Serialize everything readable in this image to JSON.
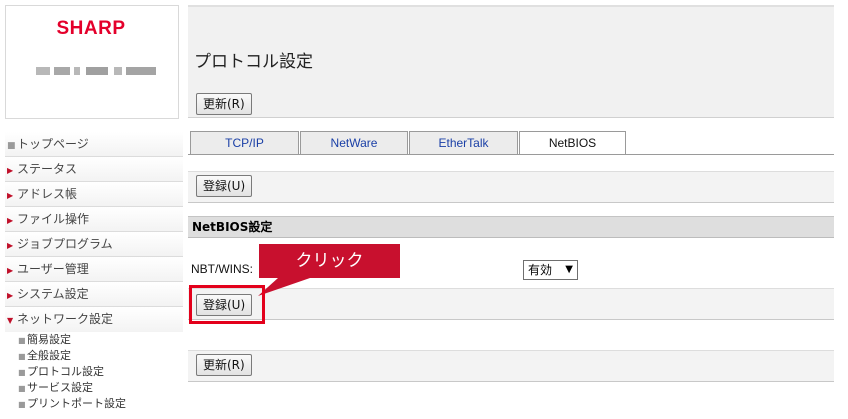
{
  "brand": {
    "logo": "SHARP"
  },
  "nav": {
    "items": [
      {
        "label": "トップページ",
        "marker": "square"
      },
      {
        "label": "ステータス",
        "marker": "arrow"
      },
      {
        "label": "アドレス帳",
        "marker": "arrow"
      },
      {
        "label": "ファイル操作",
        "marker": "arrow"
      },
      {
        "label": "ジョブプログラム",
        "marker": "arrow"
      },
      {
        "label": "ユーザー管理",
        "marker": "arrow"
      },
      {
        "label": "システム設定",
        "marker": "arrow"
      },
      {
        "label": "ネットワーク設定",
        "marker": "down"
      }
    ],
    "subitems": [
      {
        "label": "簡易設定"
      },
      {
        "label": "全般設定"
      },
      {
        "label": "プロトコル設定"
      },
      {
        "label": "サービス設定"
      },
      {
        "label": "プリントポート設定"
      }
    ]
  },
  "page": {
    "title": "プロトコル設定",
    "refresh_label": "更新(R)",
    "register_label": "登録(U)"
  },
  "tabs": [
    {
      "label": "TCP/IP",
      "active": false
    },
    {
      "label": "NetWare",
      "active": false
    },
    {
      "label": "EtherTalk",
      "active": false
    },
    {
      "label": "NetBIOS",
      "active": true
    }
  ],
  "section": {
    "title": "NetBIOS設定",
    "field_label": "NBT/WINS:",
    "field_value": "有効"
  },
  "annotation": {
    "callout_text": "クリック",
    "color": "#c8102e"
  }
}
